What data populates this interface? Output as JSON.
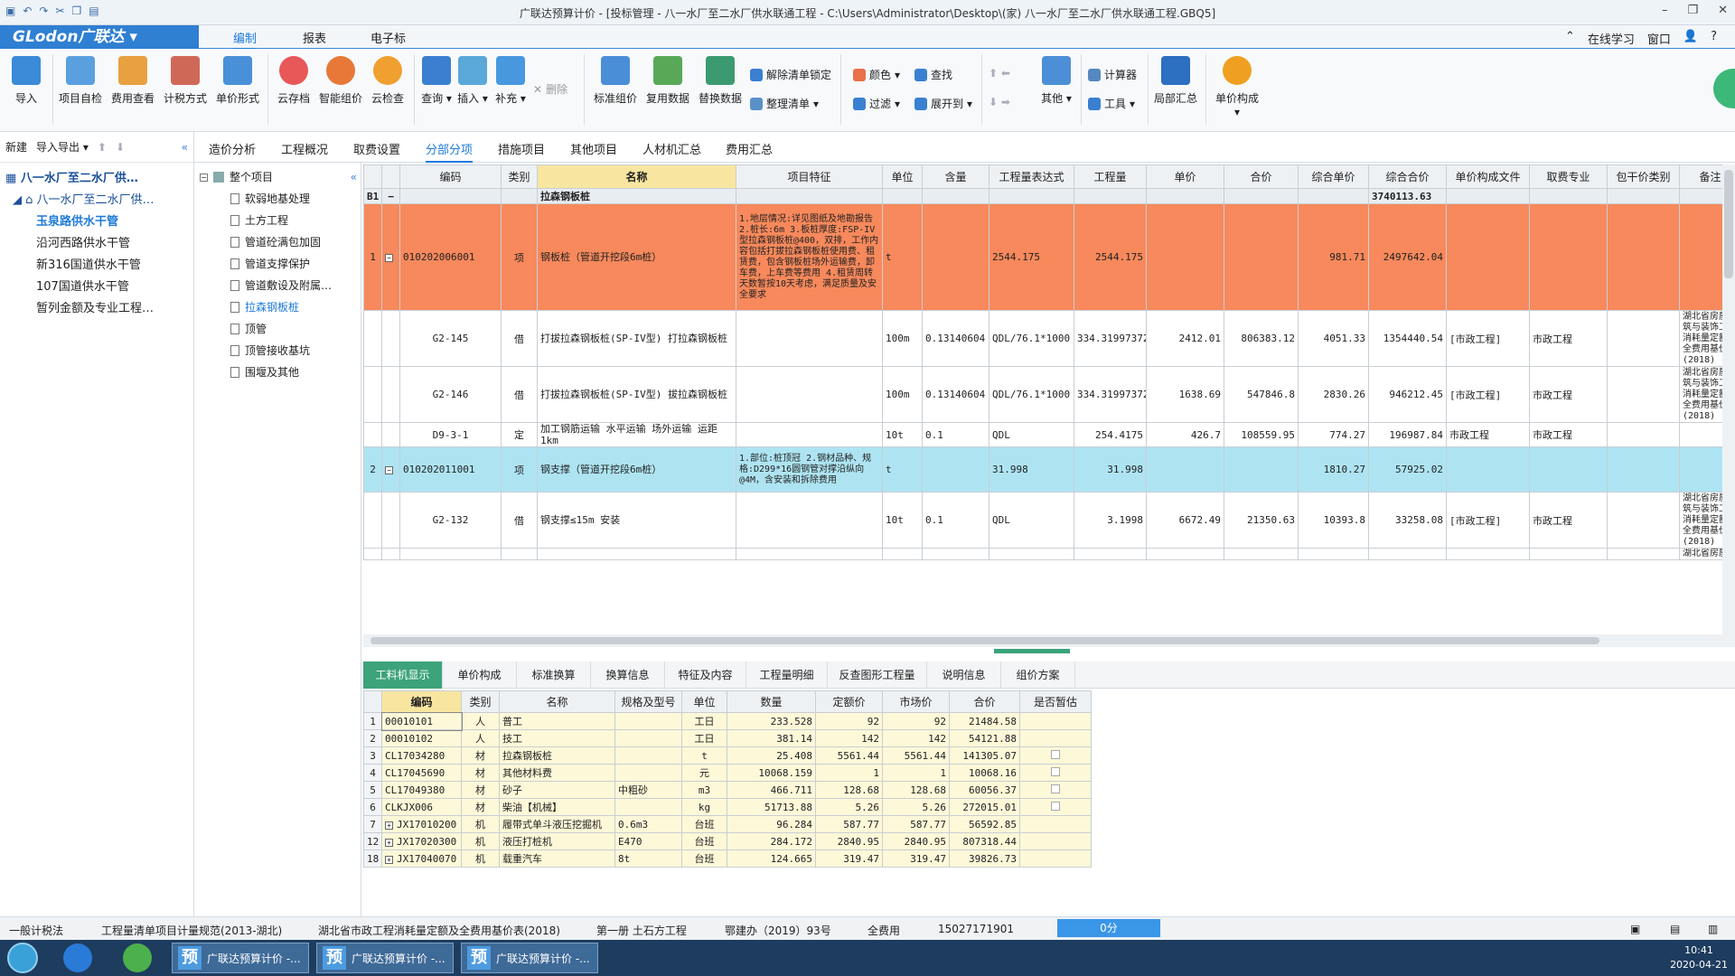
{
  "title_bar": {
    "text": "广联达预算计价 - [投标管理 - 八一水厂至二水厂供水联通工程 - C:\\Users\\Administrator\\Desktop\\(家) 八一水厂至二水厂供水联通工程.GBQ5]"
  },
  "menu": {
    "logo": "GLodon广联达",
    "tabs": [
      "编制",
      "报表",
      "电子标"
    ],
    "right": [
      "在线学习",
      "窗口"
    ]
  },
  "ribbon": {
    "big": [
      "导入",
      "项目自检",
      "费用查看",
      "计税方式",
      "单价形式",
      "云存档",
      "智能组价",
      "云检查",
      "查询",
      "插入",
      "补充",
      "标准组价",
      "复用数据",
      "替换数据",
      "其他",
      "局部汇总",
      "单价构成"
    ],
    "small": {
      "delete": "删除",
      "unlock": "解除清单锁定",
      "organize": "整理清单",
      "color": "颜色",
      "find": "查找",
      "filter": "过滤",
      "expand": "展开到",
      "calculator": "计算器",
      "tools": "工具"
    }
  },
  "leftnav": {
    "header": {
      "new": "新建",
      "import_export": "导入导出"
    },
    "items": [
      "八一水厂至二水厂供…",
      "八一水厂至二水厂供…",
      "玉泉路供水干管",
      "沿河西路供水干管",
      "新316国道供水干管",
      "107国道供水干管",
      "暂列金额及专业工程…"
    ]
  },
  "tree": {
    "root": "整个项目",
    "items": [
      "软弱地基处理",
      "土方工程",
      "管道砼满包加固",
      "管道支撑保护",
      "管道敷设及附属…",
      "拉森钢板桩",
      "顶管",
      "顶管接收基坑",
      "围堰及其他"
    ]
  },
  "top_tabs": [
    "造价分析",
    "工程概况",
    "取费设置",
    "分部分项",
    "措施项目",
    "其他项目",
    "人材机汇总",
    "费用汇总"
  ],
  "grid": {
    "headers": [
      "编码",
      "类别",
      "名称",
      "项目特征",
      "单位",
      "含量",
      "工程量表达式",
      "工程量",
      "单价",
      "合价",
      "综合单价",
      "综合合价",
      "单价构成文件",
      "取费专业",
      "包干价类别",
      "备注"
    ],
    "b1": {
      "label": "B1",
      "name": "拉森钢板桩",
      "total": "3740113.63"
    },
    "rows": [
      {
        "no": "1",
        "code": "010202006001",
        "type": "项",
        "name": "钢板桩（管道开挖段6m桩）",
        "feature": "1.地层情况:详见图纸及地勘报告\n2.桩长:6m\n3.板桩厚度:FSP-IV型拉森钢板桩@400，双排，工作内容包括打拔拉森钢板桩使用费、租赁费，包含钢板桩场外运输费，卸车费，上车费等费用\n4.租赁周转天数暂按10天考虑，满足质量及安全要求",
        "unit": "t",
        "qty_ratio": "",
        "expr": "2544.175",
        "qty": "2544.175",
        "price": "",
        "amount": "",
        "unit_price": "981.71",
        "total": "2497642.04",
        "file": "",
        "major": "",
        "pkg": "",
        "note": ""
      },
      {
        "no": "",
        "code": "G2-145",
        "type": "借",
        "name": "打拔拉森钢板桩(SP-IV型) 打拉森钢板桩",
        "feature": "",
        "unit": "100m",
        "qty_ratio": "0.13140604",
        "expr": "QDL/76.1*1000",
        "qty": "334.31997372",
        "price": "2412.01",
        "amount": "806383.12",
        "unit_price": "4051.33",
        "total": "1354440.54",
        "file": "[市政工程]",
        "major": "市政工程",
        "pkg": "",
        "note": "湖北省房屋建筑与装饰工程消耗量定额及全费用基价表(2018)"
      },
      {
        "no": "",
        "code": "G2-146",
        "type": "借",
        "name": "打拔拉森钢板桩(SP-IV型) 拔拉森钢板桩",
        "feature": "",
        "unit": "100m",
        "qty_ratio": "0.13140604",
        "expr": "QDL/76.1*1000",
        "qty": "334.31997372",
        "price": "1638.69",
        "amount": "547846.8",
        "unit_price": "2830.26",
        "total": "946212.45",
        "file": "[市政工程]",
        "major": "市政工程",
        "pkg": "",
        "note": "湖北省房屋建筑与装饰工程消耗量定额及全费用基价表(2018)"
      },
      {
        "no": "",
        "code": "D9-3-1",
        "type": "定",
        "name": "加工钢筋运输 水平运输 场外运输 运距1km",
        "feature": "",
        "unit": "10t",
        "qty_ratio": "0.1",
        "expr": "QDL",
        "qty": "254.4175",
        "price": "426.7",
        "amount": "108559.95",
        "unit_price": "774.27",
        "total": "196987.84",
        "file": "市政工程",
        "major": "市政工程",
        "pkg": "",
        "note": ""
      },
      {
        "no": "2",
        "code": "010202011001",
        "type": "项",
        "name": "钢支撑（管道开挖段6m桩）",
        "feature": "1.部位:桩顶冠\n2.钢材品种、规格:D299*16圆钢管对撑沿纵向@4M，含安装和拆除费用",
        "unit": "t",
        "qty_ratio": "",
        "expr": "31.998",
        "qty": "31.998",
        "price": "",
        "amount": "",
        "unit_price": "1810.27",
        "total": "57925.02",
        "file": "",
        "major": "",
        "pkg": "",
        "note": ""
      },
      {
        "no": "",
        "code": "G2-132",
        "type": "借",
        "name": "钢支撑≤15m 安装",
        "feature": "",
        "unit": "10t",
        "qty_ratio": "0.1",
        "expr": "QDL",
        "qty": "3.1998",
        "price": "6672.49",
        "amount": "21350.63",
        "unit_price": "10393.8",
        "total": "33258.08",
        "file": "[市政工程]",
        "major": "市政工程",
        "pkg": "",
        "note": "湖北省房屋建筑与装饰工程消耗量定额及全费用基价表(2018)"
      },
      {
        "no": "",
        "code": "",
        "type": "",
        "name": "",
        "feature": "",
        "unit": "",
        "qty_ratio": "",
        "expr": "",
        "qty": "",
        "price": "",
        "amount": "",
        "unit_price": "",
        "total": "",
        "file": "",
        "major": "",
        "pkg": "",
        "note": "湖北省房屋建"
      }
    ]
  },
  "bottom_tabs": [
    "工料机显示",
    "单价构成",
    "标准换算",
    "换算信息",
    "特征及内容",
    "工程量明细",
    "反查图形工程量",
    "说明信息",
    "组价方案"
  ],
  "sub_grid": {
    "headers": [
      "编码",
      "类别",
      "名称",
      "规格及型号",
      "单位",
      "数量",
      "定额价",
      "市场价",
      "合价",
      "是否暂估"
    ],
    "rows": [
      {
        "no": "1",
        "code": "00010101",
        "type": "人",
        "name": "普工",
        "spec": "",
        "unit": "工日",
        "qty": "233.528",
        "quota": "92",
        "market": "92",
        "total": "21484.58",
        "check": false,
        "expand": false
      },
      {
        "no": "2",
        "code": "00010102",
        "type": "人",
        "name": "技工",
        "spec": "",
        "unit": "工日",
        "qty": "381.14",
        "quota": "142",
        "market": "142",
        "total": "54121.88",
        "check": false,
        "expand": false
      },
      {
        "no": "3",
        "code": "CL17034280",
        "type": "材",
        "name": "拉森钢板桩",
        "spec": "",
        "unit": "t",
        "qty": "25.408",
        "quota": "5561.44",
        "market": "5561.44",
        "total": "141305.07",
        "check": true,
        "expand": false
      },
      {
        "no": "4",
        "code": "CL17045690",
        "type": "材",
        "name": "其他材料费",
        "spec": "",
        "unit": "元",
        "qty": "10068.159",
        "quota": "1",
        "market": "1",
        "total": "10068.16",
        "check": true,
        "expand": false
      },
      {
        "no": "5",
        "code": "CL17049380",
        "type": "材",
        "name": "砂子",
        "spec": "中粗砂",
        "unit": "m3",
        "qty": "466.711",
        "quota": "128.68",
        "market": "128.68",
        "total": "60056.37",
        "check": true,
        "expand": false
      },
      {
        "no": "6",
        "code": "CLKJX006",
        "type": "材",
        "name": "柴油【机械】",
        "spec": "",
        "unit": "kg",
        "qty": "51713.88",
        "quota": "5.26",
        "market": "5.26",
        "total": "272015.01",
        "check": true,
        "expand": false
      },
      {
        "no": "7",
        "code": "JX17010200",
        "type": "机",
        "name": "履带式单斗液压挖掘机",
        "spec": "0.6m3",
        "unit": "台班",
        "qty": "96.284",
        "quota": "587.77",
        "market": "587.77",
        "total": "56592.85",
        "check": false,
        "expand": true
      },
      {
        "no": "12",
        "code": "JX17020300",
        "type": "机",
        "name": "液压打桩机",
        "spec": "E470",
        "unit": "台班",
        "qty": "284.172",
        "quota": "2840.95",
        "market": "2840.95",
        "total": "807318.44",
        "check": false,
        "expand": true
      },
      {
        "no": "18",
        "code": "JX17040070",
        "type": "机",
        "name": "载重汽车",
        "spec": "8t",
        "unit": "台班",
        "qty": "124.665",
        "quota": "319.47",
        "market": "319.47",
        "total": "39826.73",
        "check": false,
        "expand": true
      }
    ]
  },
  "status_bar": {
    "items": [
      "一般计税法",
      "工程量清单项目计量规范(2013-湖北)",
      "湖北省市政工程消耗量定额及全费用基价表(2018)",
      "第一册 土石方工程",
      "鄂建办（2019）93号",
      "全费用",
      "15027171901"
    ],
    "progress": "0分"
  },
  "taskbar": {
    "tasks": [
      "广联达预算计价 -...",
      "广联达预算计价 -...",
      "广联达预算计价 -..."
    ],
    "time": "10:41",
    "date": "2020-04-21"
  },
  "colors": {
    "accent": "#1f7bd8",
    "row_highlight": "#f7895c",
    "row_selected": "#aee4f2",
    "tab_active": "#3ca37a"
  }
}
